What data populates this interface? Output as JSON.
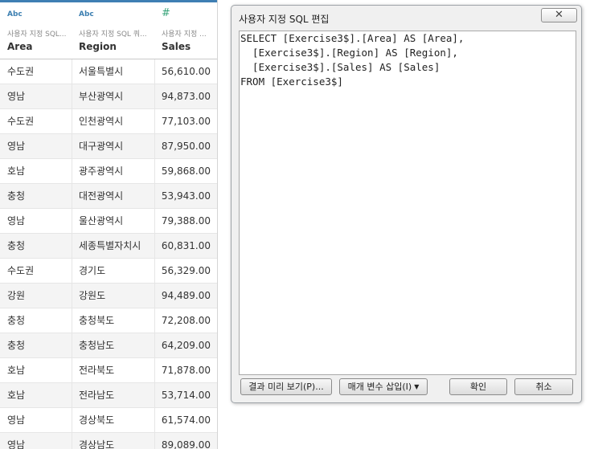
{
  "grid": {
    "columns": [
      {
        "type_icon": "Abc",
        "source": "사용자 지정 SQL...",
        "name": "Area"
      },
      {
        "type_icon": "Abc",
        "source": "사용자 지정 SQL 쿼...",
        "name": "Region"
      },
      {
        "type_icon": "#",
        "source": "사용자 지정 ...",
        "name": "Sales"
      }
    ],
    "rows": [
      {
        "area": "수도권",
        "region": "서울특별시",
        "sales": "56,610.00"
      },
      {
        "area": "영남",
        "region": "부산광역시",
        "sales": "94,873.00"
      },
      {
        "area": "수도권",
        "region": "인천광역시",
        "sales": "77,103.00"
      },
      {
        "area": "영남",
        "region": "대구광역시",
        "sales": "87,950.00"
      },
      {
        "area": "호남",
        "region": "광주광역시",
        "sales": "59,868.00"
      },
      {
        "area": "충청",
        "region": "대전광역시",
        "sales": "53,943.00"
      },
      {
        "area": "영남",
        "region": "울산광역시",
        "sales": "79,388.00"
      },
      {
        "area": "충청",
        "region": "세종특별자치시",
        "sales": "60,831.00"
      },
      {
        "area": "수도권",
        "region": "경기도",
        "sales": "56,329.00"
      },
      {
        "area": "강원",
        "region": "강원도",
        "sales": "94,489.00"
      },
      {
        "area": "충청",
        "region": "충청북도",
        "sales": "72,208.00"
      },
      {
        "area": "충청",
        "region": "충청남도",
        "sales": "64,209.00"
      },
      {
        "area": "호남",
        "region": "전라북도",
        "sales": "71,878.00"
      },
      {
        "area": "호남",
        "region": "전라남도",
        "sales": "53,714.00"
      },
      {
        "area": "영남",
        "region": "경상북도",
        "sales": "61,574.00"
      },
      {
        "area": "영남",
        "region": "경상남도",
        "sales": "89,089.00"
      }
    ]
  },
  "dialog": {
    "title": "사용자 지정 SQL 편집",
    "close_icon": "close-icon",
    "sql_lines": [
      "SELECT [Exercise3$].[Area] AS [Area],",
      "  [Exercise3$].[Region] AS [Region],",
      "  [Exercise3$].[Sales] AS [Sales]",
      "FROM [Exercise3$]"
    ],
    "buttons": {
      "preview": "결과 미리 보기(P)...",
      "insert_param": "매개 변수 삽입(I)",
      "ok": "확인",
      "cancel": "취소"
    }
  },
  "colors": {
    "accent": "#3f7fb3",
    "string_type_icon": "#3c7fb1",
    "number_type_icon": "#38a47a"
  }
}
